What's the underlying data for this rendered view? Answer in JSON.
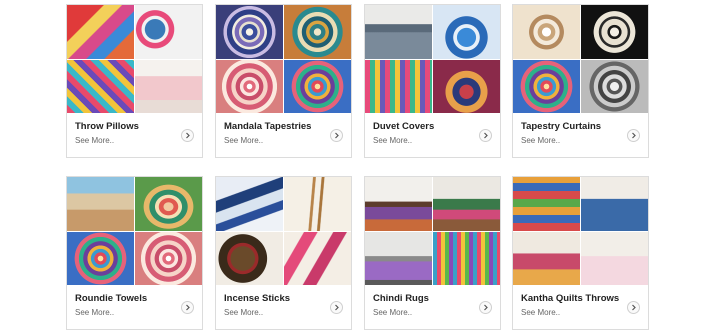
{
  "arrow_glyph": "›",
  "categories": [
    {
      "title": "Throw Pillows",
      "more": "See More..",
      "thumbs": [
        "pillow-red",
        "pillow-blue",
        "pillow-multi",
        "pillow-pink"
      ]
    },
    {
      "title": "Mandala Tapestries",
      "more": "See More..",
      "thumbs": [
        "mandala-blue",
        "mandala-teal",
        "mandala-pink",
        "mandala-multi"
      ]
    },
    {
      "title": "Duvet Covers",
      "more": "See More..",
      "thumbs": [
        "duvet1",
        "duvet2",
        "duvet3",
        "duvet4"
      ]
    },
    {
      "title": "Tapestry Curtains",
      "more": "See More..",
      "thumbs": [
        "mandala-beige",
        "mandala-black",
        "mandala-multi",
        "mandala-grey"
      ]
    },
    {
      "title": "Roundie Towels",
      "more": "See More..",
      "thumbs": [
        "beach",
        "beach-mandala",
        "mandala-multi",
        "mandala-pink"
      ]
    },
    {
      "title": "Incense Sticks",
      "more": "See More..",
      "thumbs": [
        "incense1",
        "incense2",
        "incense3",
        "incense4"
      ]
    },
    {
      "title": "Chindi Rugs",
      "more": "See More..",
      "thumbs": [
        "room1",
        "room2",
        "room3",
        "room4"
      ]
    },
    {
      "title": "Kantha Quilts Throws",
      "more": "See More..",
      "thumbs": [
        "quilt1",
        "quilt2",
        "quilt3",
        "quilt4"
      ]
    }
  ]
}
